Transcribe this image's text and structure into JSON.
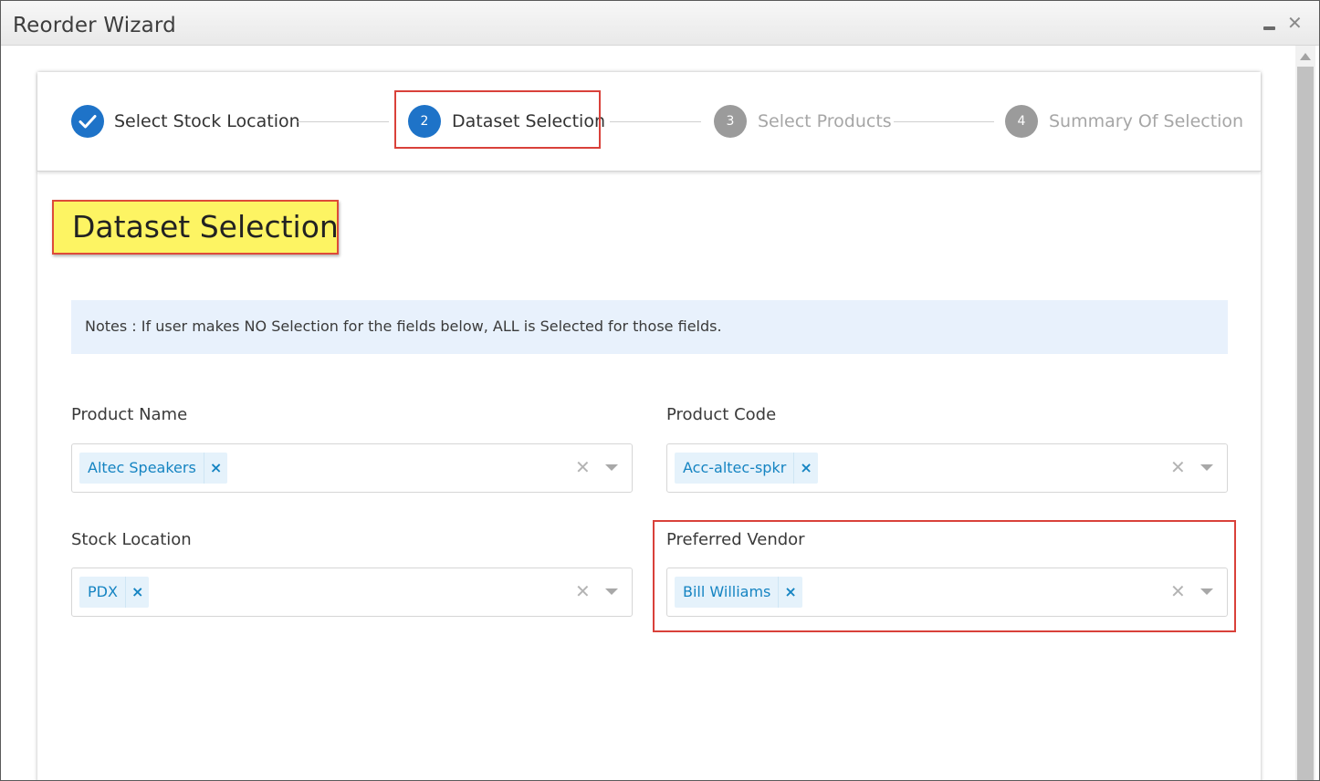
{
  "window": {
    "title": "Reorder Wizard",
    "minimize_icon": "minimize-icon",
    "close_glyph": "✕"
  },
  "stepper": {
    "steps": [
      {
        "number": "✓",
        "label": "Select Stock Location",
        "state": "completed"
      },
      {
        "number": "2",
        "label": "Dataset Selection",
        "state": "active"
      },
      {
        "number": "3",
        "label": "Select Products",
        "state": "inactive"
      },
      {
        "number": "4",
        "label": "Summary Of Selection",
        "state": "inactive"
      }
    ]
  },
  "page": {
    "heading": "Dataset Selection",
    "note": "Notes : If user makes NO Selection for the fields below, ALL is Selected for those fields."
  },
  "fields": {
    "product_name": {
      "label": "Product Name",
      "tags": [
        "Altec Speakers"
      ]
    },
    "product_code": {
      "label": "Product Code",
      "tags": [
        "Acc-altec-spkr"
      ]
    },
    "stock_location": {
      "label": "Stock Location",
      "tags": [
        "PDX"
      ]
    },
    "preferred_vendor": {
      "label": "Preferred Vendor",
      "tags": [
        "Bill Williams"
      ]
    }
  },
  "glyphs": {
    "tag_remove": "×",
    "clear": "✕"
  },
  "colors": {
    "accent": "#1e73c8",
    "inactive": "#9b9b9b",
    "tag_bg": "#e5f2fb",
    "tag_text": "#1584c2",
    "note_bg": "#e8f1fc",
    "highlight_yellow": "#fdf463",
    "annotation_red": "#d9413a"
  }
}
